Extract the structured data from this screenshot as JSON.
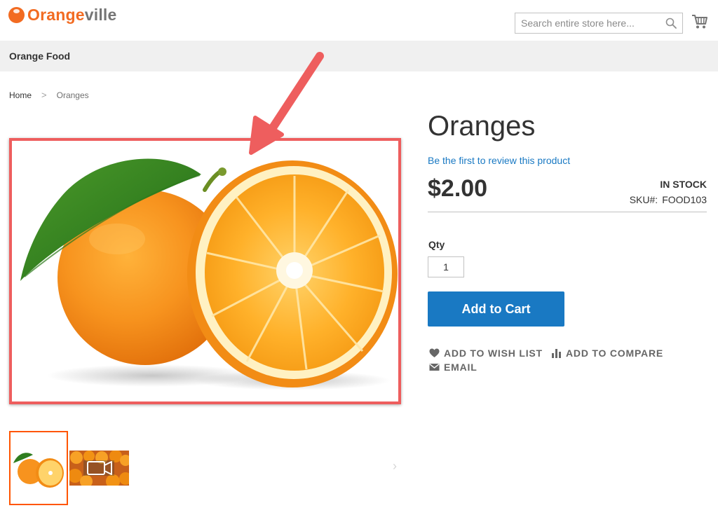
{
  "header": {
    "logo_part1": "Orange",
    "logo_part2": "ville",
    "search_placeholder": "Search entire store here..."
  },
  "nav": {
    "items": [
      {
        "label": "Orange Food"
      }
    ]
  },
  "breadcrumb": {
    "home": "Home",
    "separator": ">",
    "current": "Oranges"
  },
  "product": {
    "title": "Oranges",
    "review_link": "Be the first to review this product",
    "price": "$2.00",
    "stock": "IN STOCK",
    "sku_label": "SKU#:",
    "sku_value": "FOOD103",
    "qty_label": "Qty",
    "qty_value": "1",
    "add_to_cart": "Add to Cart"
  },
  "actions": {
    "wishlist": "ADD TO WISH LIST",
    "compare": "ADD TO COMPARE",
    "email": "EMAIL"
  },
  "gallery": {
    "next_label": "›"
  },
  "colors": {
    "brand_orange": "#f26b21",
    "link_blue": "#1979c3",
    "button_blue": "#1979c3",
    "highlight_red": "#ee5e5e",
    "nav_bg": "#f0f0f0",
    "thumb_active": "#ff5501"
  },
  "icons": [
    "logo-icon",
    "search-icon",
    "cart-icon",
    "heart-icon",
    "compare-icon",
    "envelope-icon",
    "video-icon",
    "arrow-annotation-icon",
    "chevron-right-icon"
  ]
}
